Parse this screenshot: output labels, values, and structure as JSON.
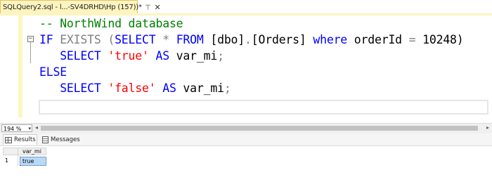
{
  "document_tab": {
    "title": "SQLQuery2.sql - l...-SV4DRHD\\Hp (157))*",
    "pin_icon": "pin-icon",
    "close_icon": "close-icon",
    "close_glyph": "✕"
  },
  "editor": {
    "lines": [
      {
        "comment": "-- NorthWind database"
      },
      {
        "kw1": "IF",
        "kw2": "EXISTS",
        "p1": " (",
        "kw3": "SELECT",
        "star": " * ",
        "kw4": "FROM",
        "obj": " [dbo]",
        "dot": ".",
        "obj2": "[Orders] ",
        "kw5": "where",
        "rest": " orderId ",
        "eq": "=",
        "num": " 10248)"
      },
      {
        "indent": "   ",
        "kw1": "SELECT",
        "sp": " ",
        "str": "'true'",
        "sp2": " ",
        "kw2": "AS",
        "rest": " var_mi",
        "semi": ";"
      },
      {
        "kw1": "ELSE"
      },
      {
        "indent": "   ",
        "kw1": "SELECT",
        "sp": " ",
        "str": "'false'",
        "sp2": " ",
        "kw2": "AS",
        "rest": " var_mi",
        "semi": ";"
      }
    ],
    "fold_glyph": "−"
  },
  "status": {
    "zoom": "194 %",
    "zoom_arrow": "▾",
    "scroll_left": "◂",
    "scroll_right": "▸"
  },
  "results_tabs": {
    "results_label": "Results",
    "messages_label": "Messages"
  },
  "results_grid": {
    "columns": [
      "var_mi"
    ],
    "rows": [
      {
        "row_number": "1",
        "values": [
          "true"
        ]
      }
    ]
  },
  "colors": {
    "keyword": "#0000ff",
    "comment": "#008000",
    "string": "#ff0000",
    "operator": "#808080",
    "tab_background": "#fdf4bf",
    "selected_cell": "#b9d9f7"
  }
}
